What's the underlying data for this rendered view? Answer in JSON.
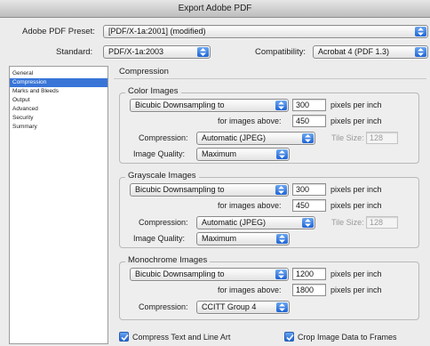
{
  "window": {
    "title": "Export Adobe PDF"
  },
  "preset": {
    "label": "Adobe PDF Preset:",
    "value": "[PDF/X-1a:2001] (modified)"
  },
  "standard": {
    "label": "Standard:",
    "value": "PDF/X-1a:2003"
  },
  "compatibility": {
    "label": "Compatibility:",
    "value": "Acrobat 4 (PDF 1.3)"
  },
  "sidebar": {
    "items": [
      {
        "label": "General"
      },
      {
        "label": "Compression",
        "selected": true
      },
      {
        "label": "Marks and Bleeds"
      },
      {
        "label": "Output"
      },
      {
        "label": "Advanced"
      },
      {
        "label": "Security"
      },
      {
        "label": "Summary"
      }
    ]
  },
  "panel": {
    "title": "Compression"
  },
  "color_images": {
    "title": "Color Images",
    "downsampling": "Bicubic Downsampling to",
    "ppi_value": "300",
    "ppi_unit": "pixels per inch",
    "above_label": "for images above:",
    "above_value": "450",
    "above_unit": "pixels per inch",
    "compression_label": "Compression:",
    "compression_value": "Automatic (JPEG)",
    "tile_label": "Tile Size:",
    "tile_value": "128",
    "quality_label": "Image Quality:",
    "quality_value": "Maximum"
  },
  "grayscale_images": {
    "title": "Grayscale Images",
    "downsampling": "Bicubic Downsampling to",
    "ppi_value": "300",
    "ppi_unit": "pixels per inch",
    "above_label": "for images above:",
    "above_value": "450",
    "above_unit": "pixels per inch",
    "compression_label": "Compression:",
    "compression_value": "Automatic (JPEG)",
    "tile_label": "Tile Size:",
    "tile_value": "128",
    "quality_label": "Image Quality:",
    "quality_value": "Maximum"
  },
  "monochrome_images": {
    "title": "Monochrome Images",
    "downsampling": "Bicubic Downsampling to",
    "ppi_value": "1200",
    "ppi_unit": "pixels per inch",
    "above_label": "for images above:",
    "above_value": "1800",
    "above_unit": "pixels per inch",
    "compression_label": "Compression:",
    "compression_value": "CCITT Group 4"
  },
  "options": {
    "compress_text": {
      "label": "Compress Text and Line Art",
      "checked": true
    },
    "crop_image": {
      "label": "Crop Image Data to Frames",
      "checked": true
    }
  },
  "colors": {
    "accent": "#3875d7",
    "background": "#ececec"
  }
}
